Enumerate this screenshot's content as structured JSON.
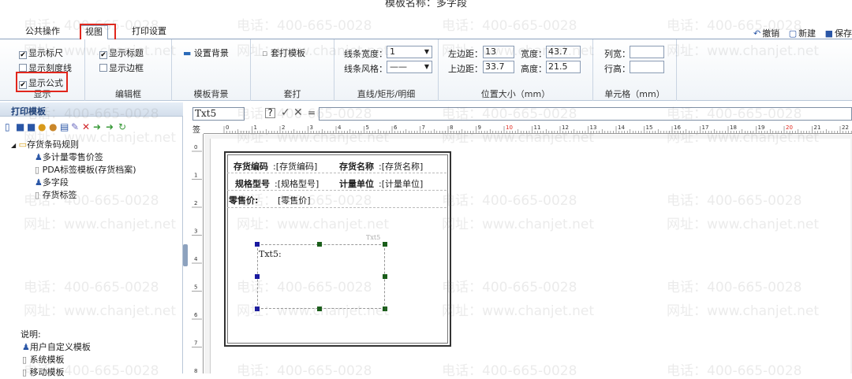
{
  "window": {
    "title": "模板名称：多字段"
  },
  "tabs": [
    {
      "label": "公共操作"
    },
    {
      "label": "视图"
    },
    {
      "label": "打印设置"
    }
  ],
  "actions": {
    "undo": "撤销",
    "new": "新建",
    "save": "保存"
  },
  "ribbon": {
    "view": {
      "show_ruler": "显示标尺",
      "show_scale": "显示刻度线",
      "show_formula": "显示公式",
      "label": "显示"
    },
    "frame": {
      "show_title": "显示标题",
      "show_border": "显示边框",
      "label": "编辑框"
    },
    "bg": {
      "set_bg": "设置背景",
      "label": "模板背景"
    },
    "overlay": {
      "btn": "套打模板",
      "label": "套打"
    },
    "line": {
      "width_label": "线条宽度：",
      "width_value": "1",
      "style_label": "线条风格：",
      "style_value": "——",
      "label": "直线/矩形/明细"
    },
    "pos": {
      "left_label": "左边距：",
      "left_value": "13",
      "width_label": "宽度：",
      "width_value": "43.7",
      "top_label": "上边距：",
      "top_value": "33.7",
      "height_label": "高度：",
      "height_value": "21.5",
      "label": "位置大小（mm）"
    },
    "cell": {
      "col_width": "列宽：",
      "row_height": "行高：",
      "label": "单元格（mm）"
    }
  },
  "left": {
    "header": "打印模板",
    "tree": {
      "root": "存货条码规则",
      "items": [
        "多计量零售价签",
        "PDA标签模板(存货档案)",
        "多字段",
        "存货标签"
      ]
    },
    "legend": {
      "title": "说明:",
      "items": [
        "用户自定义模板",
        "系统模板",
        "移动模板"
      ]
    }
  },
  "formula": {
    "name": "Txt5",
    "help": "?",
    "ok": "✓",
    "cancel": "✕",
    "eq": "="
  },
  "ruler": {
    "corner": "签",
    "h_ticks": [
      "0",
      "1",
      "2",
      "3",
      "4",
      "5",
      "6",
      "7",
      "8",
      "9",
      "10",
      "11",
      "12",
      "13",
      "14",
      "15",
      "16",
      "17",
      "18",
      "19",
      "20",
      "21",
      "22"
    ],
    "v_ticks": [
      "0",
      "1",
      "2",
      "3",
      "4",
      "5",
      "6",
      "7",
      "8"
    ]
  },
  "label": {
    "row1": {
      "k1": "存货编码",
      "v1": ":[存货编码]",
      "k2": "存货名称",
      "v2": ":[存货名称]"
    },
    "row2": {
      "k1": "规格型号",
      "v1": ":[规格型号]",
      "k2": "计量单位",
      "v2": ":[计量单位]"
    },
    "row3": {
      "k1": "零售价:",
      "v1": "[零售价]"
    },
    "txt5_tag": "Txt5",
    "txt5_text": "Txt5:"
  },
  "watermark": {
    "phone": "电话：400-665-0028",
    "site": "网址：www.chanjet.net"
  },
  "colors": {
    "highlight": "#e1261c",
    "ribbon_border": "#8da2be",
    "handle_green": "#1a5e1a",
    "handle_blue": "#1a1aa0"
  }
}
